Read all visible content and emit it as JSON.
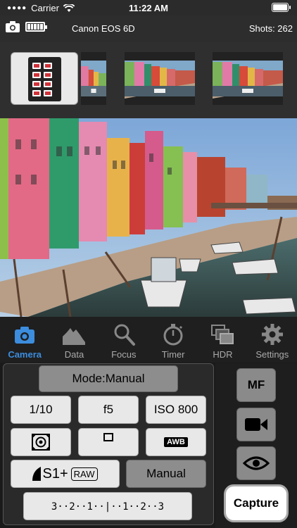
{
  "status_bar": {
    "carrier": "Carrier",
    "time": "11:22 AM"
  },
  "header": {
    "camera_model": "Canon EOS 6D",
    "shots": "Shots: 262"
  },
  "tabs": [
    {
      "label": "Camera",
      "icon": "camera-icon",
      "active": true
    },
    {
      "label": "Data",
      "icon": "histogram-icon",
      "active": false
    },
    {
      "label": "Focus",
      "icon": "magnifier-icon",
      "active": false
    },
    {
      "label": "Timer",
      "icon": "stopwatch-icon",
      "active": false
    },
    {
      "label": "HDR",
      "icon": "hdr-icon",
      "active": false
    },
    {
      "label": "Settings",
      "icon": "gear-icon",
      "active": false
    }
  ],
  "controls": {
    "mode": "Mode:Manual",
    "shutter": "1/10",
    "aperture": "f5",
    "iso": "ISO 800",
    "metering_icon": "metering-icon",
    "af_point_icon": "af-point-icon",
    "white_balance": "AWB",
    "quality_prefix": "S1+",
    "quality_raw": "RAW",
    "focus_mode": "Manual",
    "exposure_scale": "3··2··1··|··1··2··3"
  },
  "side": {
    "mf": "MF",
    "video_icon": "video-camera-icon",
    "eye_icon": "eye-icon",
    "capture": "Capture"
  },
  "colors": {
    "accent": "#3c8dde",
    "background": "#1a1a1a"
  }
}
